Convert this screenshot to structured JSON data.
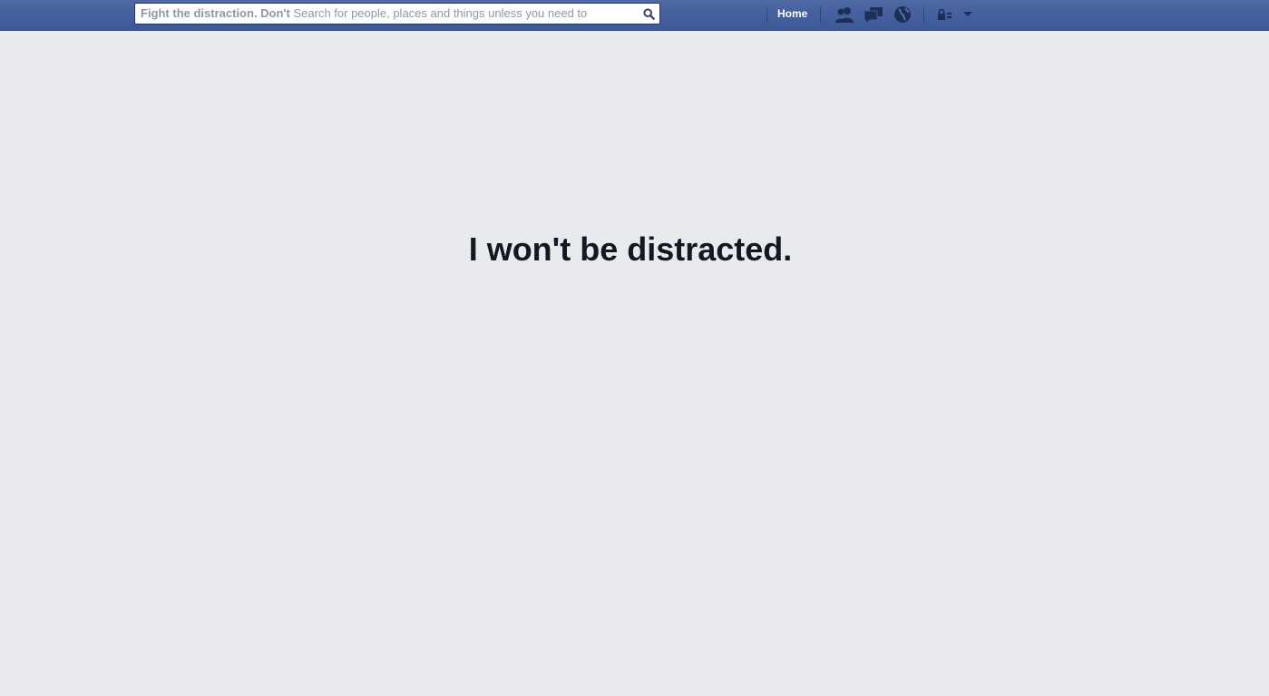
{
  "header": {
    "search": {
      "prefix": "Fight the distraction. Don't",
      "placeholder": "Search for people, places and things unless you need to"
    },
    "nav": {
      "home_label": "Home"
    },
    "icons": {
      "search": "search-icon",
      "friend_requests": "friends-icon",
      "messages": "messages-icon",
      "notifications": "globe-icon",
      "privacy": "privacy-lock-icon",
      "account_menu": "chevron-down-icon"
    }
  },
  "main": {
    "message": "I won't be distracted."
  },
  "colors": {
    "topbar": "#3b5998",
    "background": "#e9eaed",
    "text": "#141823"
  }
}
